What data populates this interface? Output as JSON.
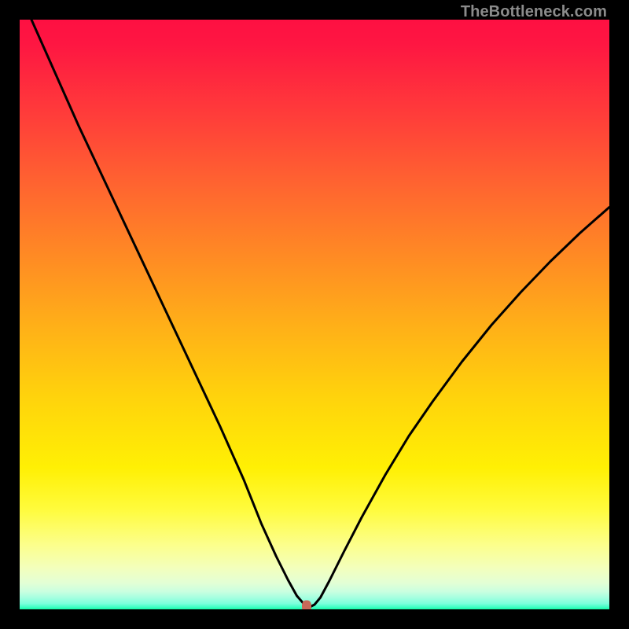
{
  "watermark": "TheBottleneck.com",
  "marker": {
    "x_pct": 48.7,
    "y_pct": 99.4,
    "color": "#c66959"
  },
  "chart_data": {
    "type": "line",
    "title": "",
    "xlabel": "",
    "ylabel": "",
    "xlim": [
      0,
      100
    ],
    "ylim": [
      0,
      100
    ],
    "grid": false,
    "series": [
      {
        "name": "left-curve",
        "x": [
          2.0,
          6.0,
          10.0,
          14.0,
          18.0,
          22.0,
          26.0,
          30.0,
          34.0,
          38.0,
          41.0,
          43.5,
          45.5,
          47.0,
          48.3,
          49.2
        ],
        "y": [
          100.0,
          91.0,
          82.0,
          73.5,
          65.0,
          56.5,
          48.0,
          39.5,
          31.0,
          22.0,
          14.5,
          9.0,
          5.0,
          2.3,
          0.8,
          0.4
        ]
      },
      {
        "name": "right-curve",
        "x": [
          49.2,
          50.0,
          51.0,
          52.5,
          55.0,
          58.0,
          62.0,
          66.0,
          70.0,
          75.0,
          80.0,
          85.0,
          90.0,
          95.0,
          100.0
        ],
        "y": [
          0.4,
          0.8,
          2.0,
          4.8,
          9.8,
          15.6,
          22.8,
          29.4,
          35.2,
          42.0,
          48.2,
          53.8,
          59.0,
          63.8,
          68.2
        ]
      }
    ],
    "annotations": [
      {
        "type": "marker",
        "x": 48.7,
        "y": 0.6,
        "color": "#c66959"
      }
    ],
    "background_gradient": {
      "direction": "top-to-bottom",
      "stops": [
        {
          "pct": 0,
          "color": "#fe1042"
        },
        {
          "pct": 50,
          "color": "#ffb018"
        },
        {
          "pct": 80,
          "color": "#fff53a"
        },
        {
          "pct": 100,
          "color": "#15f7a6"
        }
      ]
    }
  }
}
